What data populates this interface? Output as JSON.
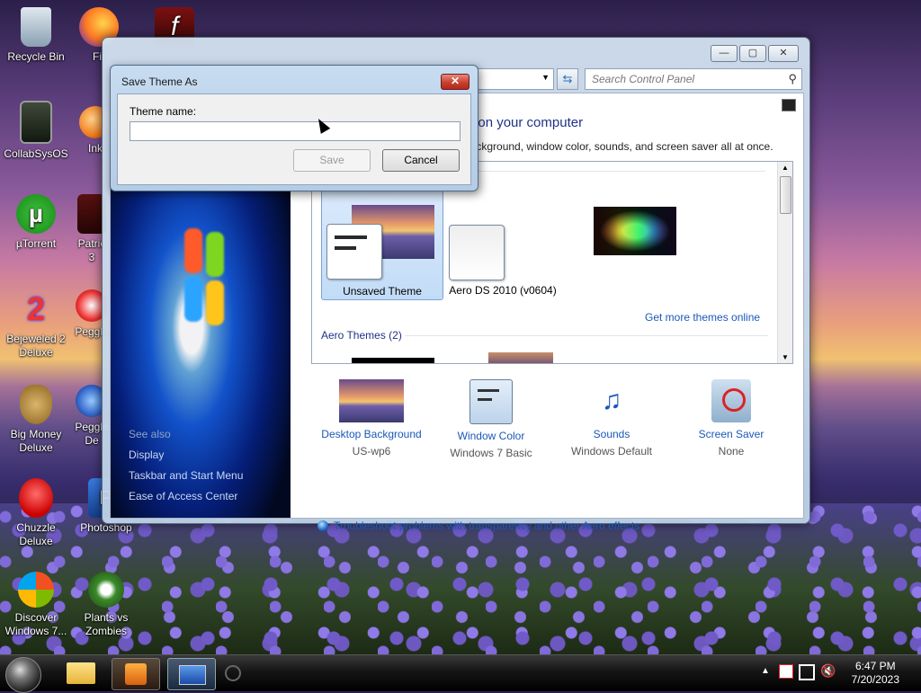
{
  "desktop": {
    "icons": [
      {
        "label": "Recycle Bin"
      },
      {
        "label": "Fir"
      },
      {
        "label": "CollabSysOS"
      },
      {
        "label": "Ink"
      },
      {
        "label": "µTorrent"
      },
      {
        "label": "Patric\n3"
      },
      {
        "label": "Bejeweled 2\nDeluxe"
      },
      {
        "label": "Peggle"
      },
      {
        "label": "Big Money\nDeluxe"
      },
      {
        "label": "Peggle\nDe"
      },
      {
        "label": "Chuzzle\nDeluxe"
      },
      {
        "label": "Photoshop"
      },
      {
        "label": "Discover\nWindows 7..."
      },
      {
        "label": "Plants vs\nZombies"
      }
    ]
  },
  "control_panel": {
    "search_placeholder": "Search Control Panel",
    "heading_partial": "nds on your computer",
    "subheading_partial": "p background, window color, sounds, and screen saver all at once.",
    "my_themes": [
      {
        "name": "Unsaved Theme"
      },
      {
        "name": "Aero DS 2010 (v0604)"
      }
    ],
    "get_more_link": "Get more themes online",
    "aero_themes_label": "Aero Themes (2)",
    "left_links": [
      "Display",
      "Taskbar and Start Menu",
      "Ease of Access Center"
    ],
    "left_see_also": "See also",
    "bottom": [
      {
        "link": "Desktop Background",
        "sub": "US-wp6"
      },
      {
        "link": "Window Color",
        "sub": "Windows 7 Basic"
      },
      {
        "link": "Sounds",
        "sub": "Windows Default"
      },
      {
        "link": "Screen Saver",
        "sub": "None"
      }
    ],
    "troubleshoot_link": "Troubleshoot problems with transparency and other Aero effects"
  },
  "dialog": {
    "title": "Save Theme As",
    "field_label": "Theme name:",
    "field_value": "",
    "save_label": "Save",
    "cancel_label": "Cancel",
    "close_glyph": "✕"
  },
  "taskbar": {
    "time": "6:47 PM",
    "date": "7/20/2023"
  },
  "colors": {
    "link": "#1a58b8",
    "heading": "#1e3287",
    "close_red": "#c8412d"
  }
}
